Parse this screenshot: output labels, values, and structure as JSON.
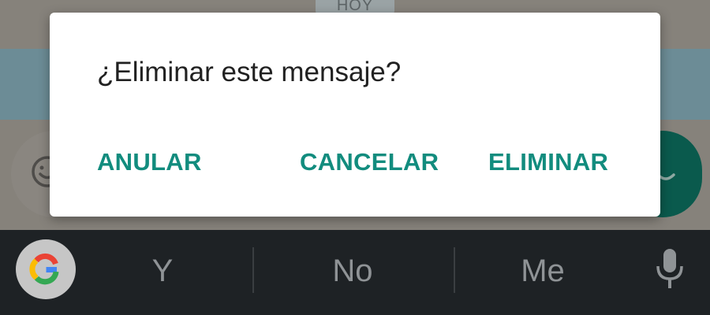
{
  "chat": {
    "date_chip": "HOY"
  },
  "dialog": {
    "title": "¿Eliminar este mensaje?",
    "buttons": {
      "anular": "ANULAR",
      "cancelar": "CANCELAR",
      "eliminar": "ELIMINAR"
    }
  },
  "keyboard": {
    "suggestions": [
      "Y",
      "No",
      "Me"
    ]
  },
  "colors": {
    "accent": "#128c7e",
    "dialog_bg": "#ffffff",
    "title_text": "#212121",
    "keyboard_bg": "#1e2225",
    "suggestion_text": "#8f9396"
  },
  "icons": {
    "emoji": "emoji-icon",
    "send": "send-icon",
    "google": "google-icon",
    "mic": "mic-icon"
  }
}
